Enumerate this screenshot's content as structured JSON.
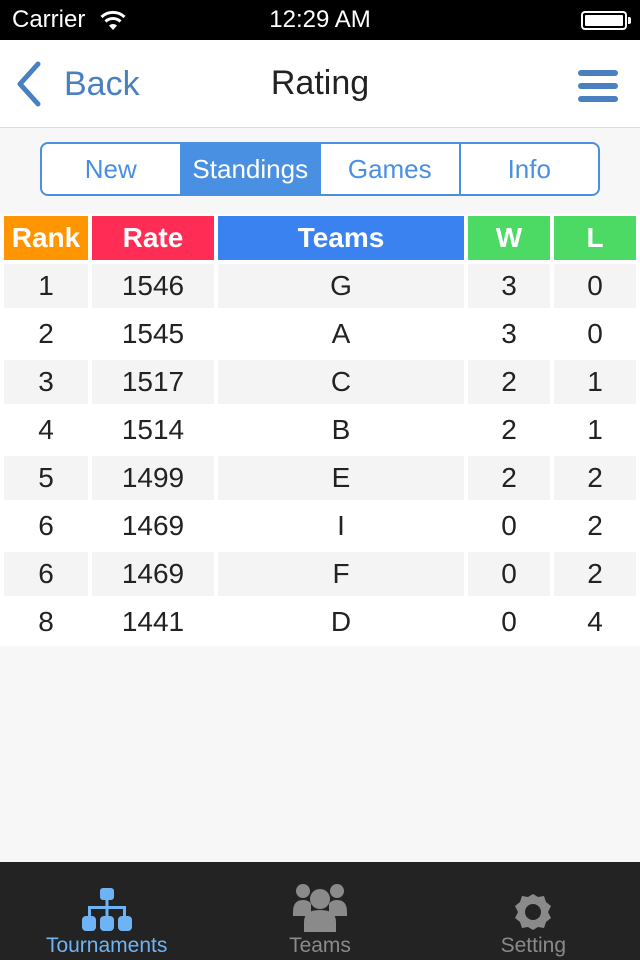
{
  "status_bar": {
    "carrier": "Carrier",
    "time": "12:29 AM",
    "wifi_icon": "wifi-icon",
    "battery_icon": "battery-full-icon"
  },
  "nav": {
    "back_label": "Back",
    "back_icon": "chevron-left-icon",
    "title": "Rating",
    "menu_icon": "hamburger-menu-icon"
  },
  "segments": [
    {
      "label": "New",
      "active": false
    },
    {
      "label": "Standings",
      "active": true
    },
    {
      "label": "Games",
      "active": false
    },
    {
      "label": "Info",
      "active": false
    }
  ],
  "table": {
    "headers": [
      {
        "label": "Rank",
        "color": "#ff9500"
      },
      {
        "label": "Rate",
        "color": "#ff2d55"
      },
      {
        "label": "Teams",
        "color": "#3a82f0"
      },
      {
        "label": "W",
        "color": "#4cd964"
      },
      {
        "label": "L",
        "color": "#4cd964"
      }
    ],
    "rows": [
      {
        "rank": "1",
        "rate": "1546",
        "team": "G",
        "w": "3",
        "l": "0"
      },
      {
        "rank": "2",
        "rate": "1545",
        "team": "A",
        "w": "3",
        "l": "0"
      },
      {
        "rank": "3",
        "rate": "1517",
        "team": "C",
        "w": "2",
        "l": "1"
      },
      {
        "rank": "4",
        "rate": "1514",
        "team": "B",
        "w": "2",
        "l": "1"
      },
      {
        "rank": "5",
        "rate": "1499",
        "team": "E",
        "w": "2",
        "l": "2"
      },
      {
        "rank": "6",
        "rate": "1469",
        "team": "I",
        "w": "0",
        "l": "2"
      },
      {
        "rank": "6",
        "rate": "1469",
        "team": "F",
        "w": "0",
        "l": "2"
      },
      {
        "rank": "8",
        "rate": "1441",
        "team": "D",
        "w": "0",
        "l": "4"
      }
    ]
  },
  "tab_bar": {
    "items": [
      {
        "label": "Tournaments",
        "icon": "tournament-bracket-icon",
        "active": true
      },
      {
        "label": "Teams",
        "icon": "group-users-icon",
        "active": false
      },
      {
        "label": "Setting",
        "icon": "gear-icon",
        "active": false
      }
    ]
  },
  "colors": {
    "accent": "#4a90e2",
    "nav_tint": "#4a80c0",
    "tab_active": "#6eb4f5",
    "tab_inactive": "#8a8a8a"
  }
}
